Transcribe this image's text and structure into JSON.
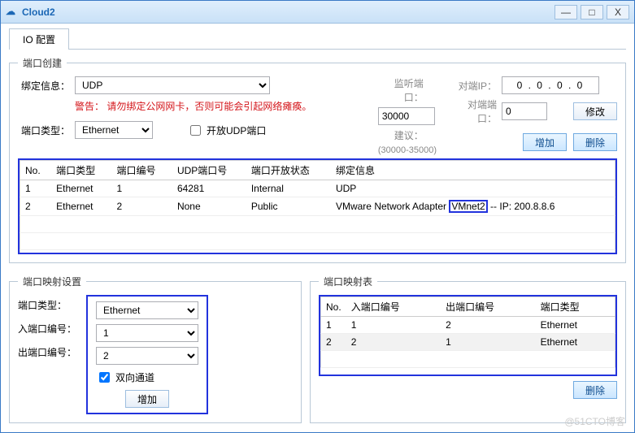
{
  "window": {
    "title": "Cloud2"
  },
  "winctrl": {
    "min": "—",
    "max": "□",
    "close": "X"
  },
  "tabs": {
    "io": "IO 配置"
  },
  "portCreate": {
    "legend": "端口创建",
    "bindLabel": "绑定信息：",
    "bindValue": "UDP",
    "warning": "警告：  请勿绑定公网网卡，否则可能会引起网络瘫痪。",
    "typeLabel": "端口类型：",
    "typeValue": "Ethernet",
    "openUdpLabel": "开放UDP端口",
    "listenLabel": "监听端口：",
    "listenValue": "30000",
    "suggestLabel": "建议：",
    "suggestRange": "(30000-35000)",
    "peerIpLabel": "对端IP：",
    "peerIpValue": "0 . 0 . 0 . 0",
    "peerPortLabel": "对端端口：",
    "peerPortValue": "0",
    "modifyBtn": "修改",
    "addBtn": "增加",
    "delBtn": "删除",
    "cols": {
      "no": "No.",
      "ptype": "端口类型",
      "pnum": "端口编号",
      "udp": "UDP端口号",
      "open": "端口开放状态",
      "bind": "绑定信息"
    },
    "rows": [
      {
        "no": "1",
        "ptype": "Ethernet",
        "pnum": "1",
        "udp": "64281",
        "open": "Internal",
        "bind": "UDP"
      },
      {
        "no": "2",
        "ptype": "Ethernet",
        "pnum": "2",
        "udp": "None",
        "open": "Public",
        "bind_pre": "VMware Network Adapter ",
        "bind_hl": "VMnet2",
        "bind_post": " -- IP: 200.8.8.6"
      }
    ]
  },
  "mapSet": {
    "legend": "端口映射设置",
    "typeLabel": "端口类型：",
    "typeValue": "Ethernet",
    "inLabel": "入端口编号：",
    "inValue": "1",
    "outLabel": "出端口编号：",
    "outValue": "2",
    "bidirLabel": "双向通道",
    "addBtn": "增加"
  },
  "mapTbl": {
    "legend": "端口映射表",
    "cols": {
      "no": "No.",
      "in": "入端口编号",
      "out": "出端口编号",
      "ptype": "端口类型"
    },
    "rows": [
      {
        "no": "1",
        "in": "1",
        "out": "2",
        "ptype": "Ethernet"
      },
      {
        "no": "2",
        "in": "2",
        "out": "1",
        "ptype": "Ethernet"
      }
    ],
    "delBtn": "删除"
  },
  "watermark": "@51CTO博客"
}
